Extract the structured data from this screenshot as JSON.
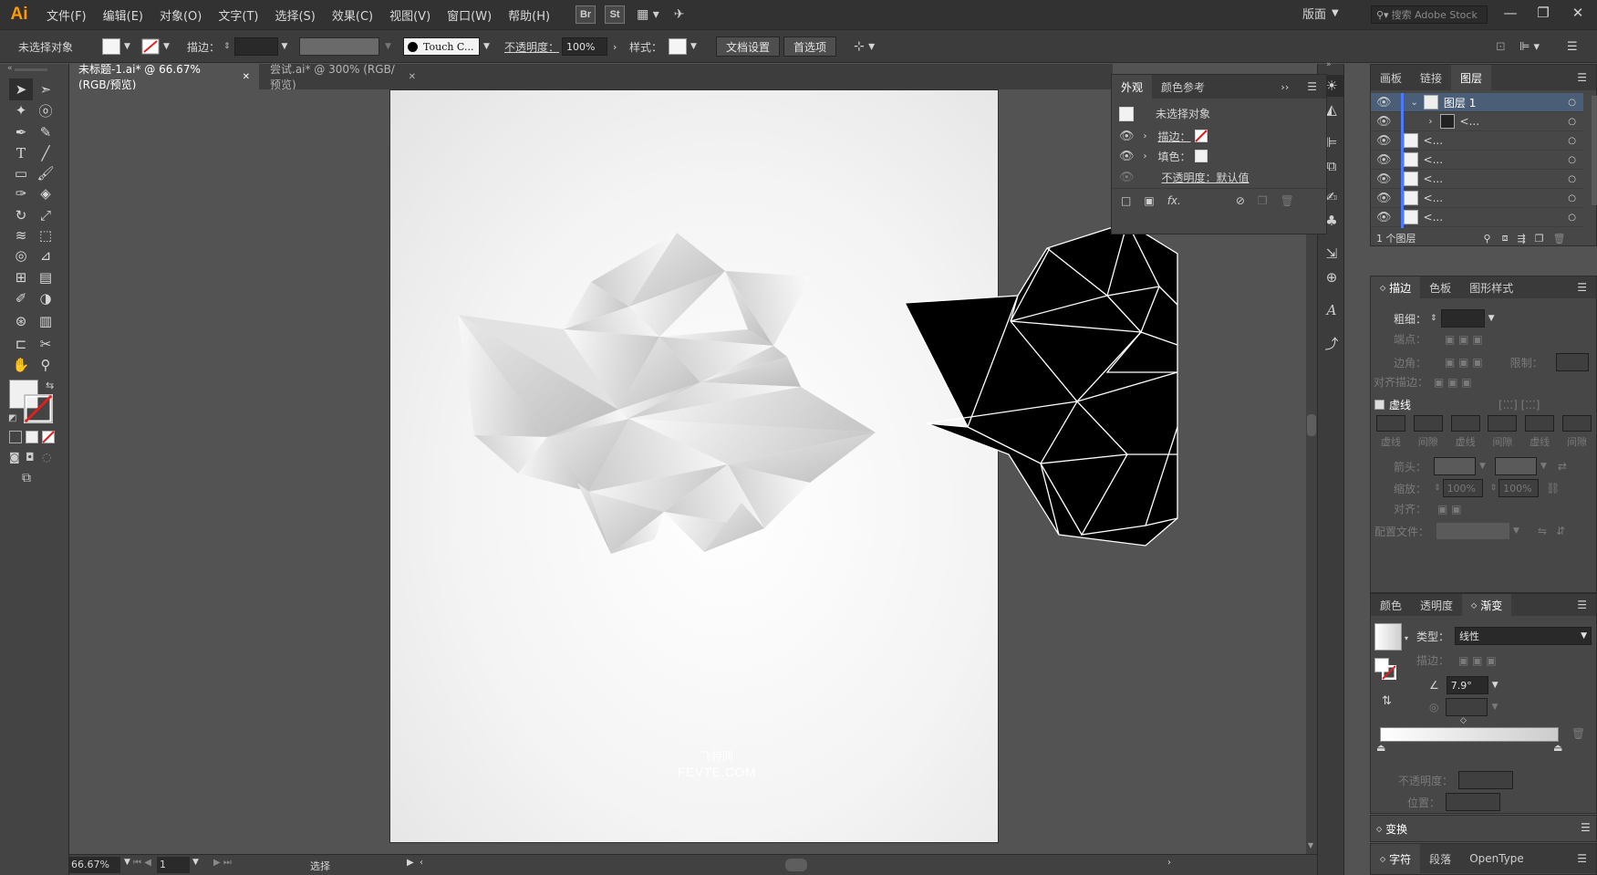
{
  "app": {
    "logo": "Ai",
    "menus": [
      "文件(F)",
      "编辑(E)",
      "对象(O)",
      "文字(T)",
      "选择(S)",
      "效果(C)",
      "视图(V)",
      "窗口(W)",
      "帮助(H)"
    ],
    "bridge_label": "Br",
    "stock_label": "St",
    "workspace": "版面",
    "search_placeholder": "搜索 Adobe Stock",
    "window_buttons": [
      "—",
      "❐",
      "✕"
    ]
  },
  "control_bar": {
    "selection_status": "未选择对象",
    "stroke_label": "描边：",
    "brush_value": "Touch C...",
    "opacity_label": "不透明度：",
    "opacity_value": "100%",
    "style_label": "样式：",
    "doc_setup_button": "文档设置",
    "prefs_button": "首选项"
  },
  "tabs": [
    {
      "label": "未标题-1.ai* @ 66.67% (RGB/预览)",
      "active": true
    },
    {
      "label": "尝试.ai* @ 300% (RGB/预览)",
      "active": false
    }
  ],
  "appearance_panel": {
    "tabs": [
      "外观",
      "颜色参考"
    ],
    "title": "未选择对象",
    "stroke_label": "描边：",
    "fill_label": "填色：",
    "opacity_text": "不透明度：默认值",
    "fx_label": "fx."
  },
  "layers_panel": {
    "tabs": [
      "画板",
      "链接",
      "图层"
    ],
    "layer_name": "图层 1",
    "sublayer_label": "<...",
    "sublayer_count": 7,
    "footer_count": "1 个图层"
  },
  "stroke_panel": {
    "tabs": [
      "描边",
      "色板",
      "图形样式"
    ],
    "weight_label": "粗细：",
    "cap_label": "端点：",
    "corner_label": "边角：",
    "limit_label": "限制：",
    "align_label": "对齐描边：",
    "dashed_label": "虚线",
    "dash_labels": [
      "虚线",
      "间隙",
      "虚线",
      "间隙",
      "虚线",
      "间隙"
    ],
    "arrow_label": "箭头：",
    "scale_label": "缩放：",
    "scale_values": [
      "100%",
      "100%"
    ],
    "align_arrow_label": "对齐：",
    "profile_label": "配置文件："
  },
  "gradient_panel": {
    "tabs": [
      "颜色",
      "透明度",
      "渐变"
    ],
    "type_label": "类型：",
    "type_value": "线性",
    "stroke_label": "描边：",
    "angle_value": "7.9°",
    "opacity_label": "不透明度：",
    "position_label": "位置："
  },
  "collapsed_panels": {
    "transform": "变换",
    "character_tabs": [
      "字符",
      "段落",
      "OpenType"
    ]
  },
  "status_bar": {
    "zoom": "66.67%",
    "artboard_number": "1",
    "tool_status": "选择"
  },
  "watermark": {
    "line1": "飞特网",
    "line2": "FEVTE.COM"
  },
  "colors": {
    "accent": "#4a6fa5",
    "logo": "#ff9a00",
    "layer_color": "#4a7bff"
  }
}
